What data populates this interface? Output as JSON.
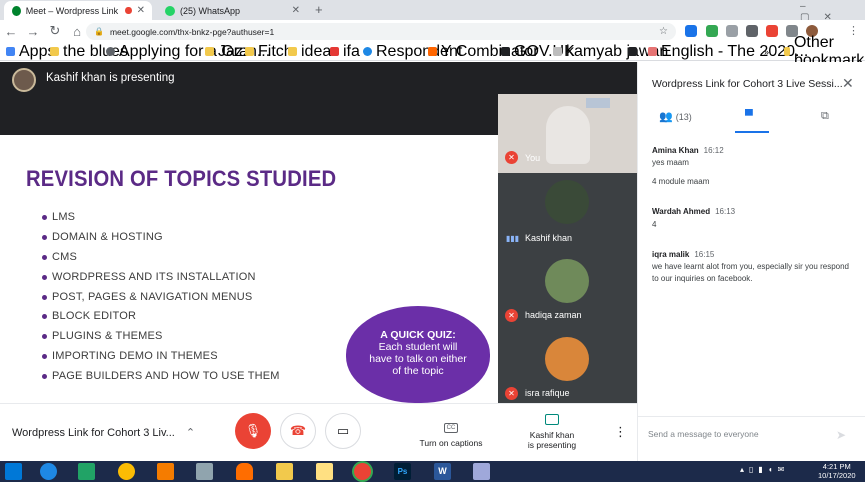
{
  "browser": {
    "tabs": [
      {
        "title": "Meet – Wordpress Link for C",
        "active": true
      },
      {
        "title": "(25) WhatsApp",
        "active": false
      }
    ],
    "new_tab": "+",
    "url": "meet.google.com/thx-bnkz-pge?authuser=1"
  },
  "bookmarks": [
    "Apps",
    "the blues",
    "Applying for a Gran...",
    "Jazz",
    "Fitch",
    "ideas",
    "ifa",
    "Respondent",
    "Y Combinator",
    "GOV.UK",
    "kamyab jawan",
    "English - The 2020...",
    "Other bookmarks"
  ],
  "bookmarks_more": "»",
  "meet": {
    "presenter_banner": "Kashif khan is presenting",
    "slide": {
      "title": "REVISION OF TOPICS STUDIED",
      "topics": [
        "LMS",
        "DOMAIN & HOSTING",
        "CMS",
        "WORDPRESS AND ITS INSTALLATION",
        "POST, PAGES & NAVIGATION MENUS",
        "BLOCK EDITOR",
        "PLUGINS & THEMES",
        "IMPORTING DEMO IN THEMES",
        "PAGE BUILDERS AND HOW TO USE THEM"
      ],
      "quiz": {
        "title": "A QUICK QUIZ:",
        "text": "Each student will have to talk on either of the topic"
      }
    },
    "participants": [
      {
        "name": "You"
      },
      {
        "name": "Kashif khan"
      },
      {
        "name": "hadiqa zaman"
      },
      {
        "name": "isra rafique"
      }
    ],
    "meeting_title": "Wordpress Link for Cohort 3 Liv...",
    "captions_label": "Turn on captions",
    "presenting_label_1": "Kashif khan",
    "presenting_label_2": "is presenting"
  },
  "panel": {
    "title": "Wordpress Link for Cohort 3 Live Sessi...",
    "people_count": "(13)",
    "messages": [
      {
        "author": "Amina Khan",
        "time": "16:12",
        "lines": [
          "yes maam",
          "4 module maam"
        ]
      },
      {
        "author": "Wardah Ahmed",
        "time": "16:13",
        "lines": [
          "4"
        ]
      },
      {
        "author": "iqra malik",
        "time": "16:15",
        "lines": [
          "we have learnt alot from you, especially sir you respond to our inquiries on facebook."
        ]
      }
    ],
    "input_placeholder": "Send a message to everyone"
  },
  "taskbar": {
    "time": "4:21 PM",
    "date": "10/17/2020"
  },
  "colors": {
    "accent": "#1a73e8",
    "mic_off": "#ea4335",
    "slide_purple": "#5b2a86",
    "quiz_bubble": "#6b2fa8"
  }
}
